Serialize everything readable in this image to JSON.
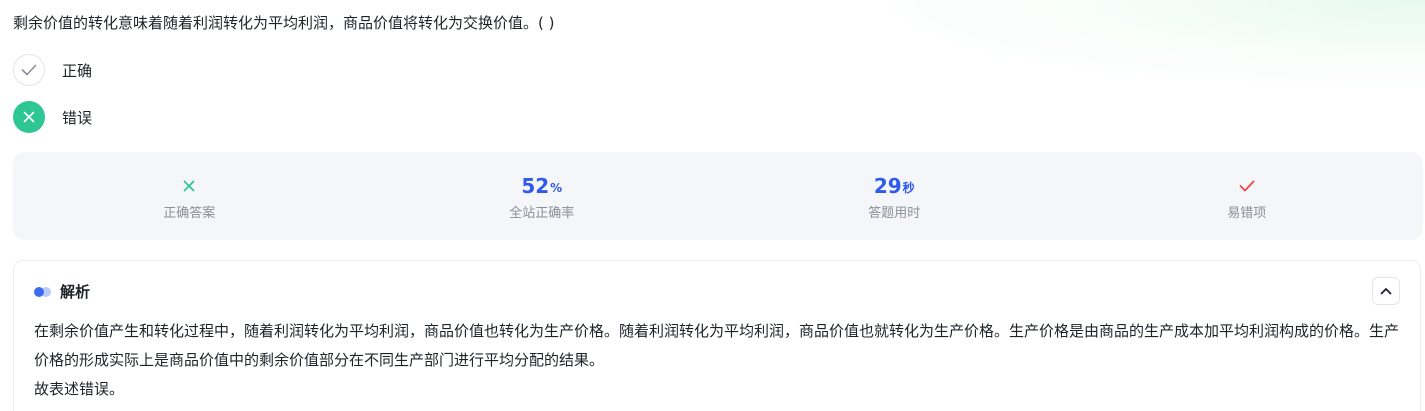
{
  "question": {
    "text": "剩余价值的转化意味着随着利润转化为平均利润，商品价值将转化为交换价值。( )"
  },
  "options": [
    {
      "label": "正确",
      "icon": "check-icon",
      "state": "unselected"
    },
    {
      "label": "错误",
      "icon": "close-icon",
      "state": "selected",
      "color": "#2ec794"
    }
  ],
  "stats": {
    "correct_answer": {
      "icon": "close-icon",
      "label": "正确答案",
      "color": "#2ec794"
    },
    "site_accuracy": {
      "value": "52",
      "unit": "%",
      "label": "全站正确率"
    },
    "answer_time": {
      "value": "29",
      "unit": "秒",
      "label": "答题用时"
    },
    "error_prone": {
      "icon": "check-icon",
      "label": "易错项",
      "color": "#f04747"
    }
  },
  "analysis": {
    "title": "解析",
    "paragraph_1": "在剩余价值产生和转化过程中，随着利润转化为平均利润，商品价值也转化为生产价格。随着利润转化为平均利润，商品价值也就转化为生产价格。生产价格是由商品的生产成本加平均利润构成的价格。生产价格的形成实际上是商品价值中的剩余价值部分在不同生产部门进行平均分配的结果。",
    "paragraph_2": "故表述错误。",
    "collapse_icon": "chevron-up-icon"
  },
  "colors": {
    "accent_blue": "#2e5bea",
    "success_green": "#2ec794",
    "error_red": "#f04747"
  }
}
